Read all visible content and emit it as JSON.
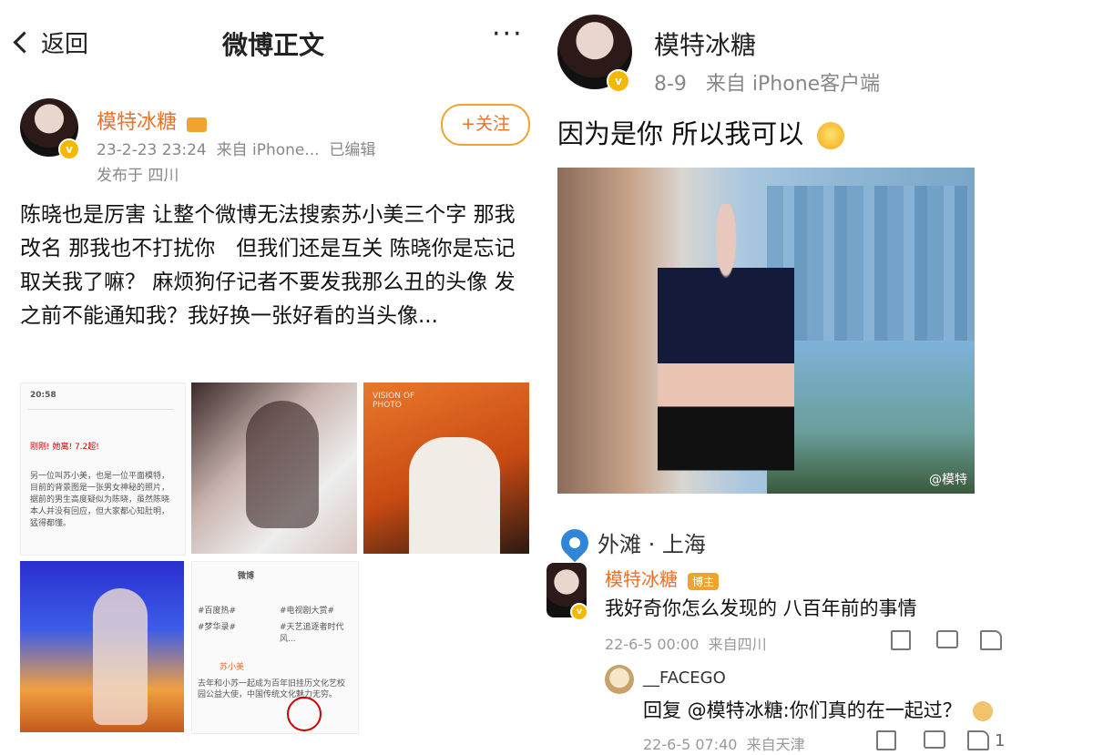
{
  "left": {
    "header": {
      "back_label": "返回",
      "title": "微博正文",
      "more_label": "···"
    },
    "author": {
      "name": "模特冰糖",
      "date": "23-2-23 23:24",
      "source": "来自 iPhone...",
      "edited": "已编辑",
      "location": "发布于 四川"
    },
    "follow_label": "+关注",
    "post_text": "陈晓也是厉害 让整个微博无法搜索苏小美三个字 那我改名 那我也不打扰你　但我们还是互关 陈晓你是忘记取关我了嘛？ 麻烦狗仔记者不要发我那么丑的头像 发之前不能通知我？我好换一张好看的当头像...",
    "thumb1": {
      "time": "20:58",
      "headline": "刚刚! 她离! 7.2超!",
      "body": "另一位叫苏小美，也是一位平面模特，目前的背景图是一张男女神秘的照片，据前的男生高度疑似为陈晓，虽然陈晓本人并没有回应，但大家都心知肚明，猛得都懂。"
    },
    "thumb3": {
      "text": "VISION OF PHOTO"
    },
    "thumb5": {
      "tab": "微博",
      "tags": [
        "#百度热#",
        "#电视剧大赏#",
        "#梦华录#",
        "#天艺追逐者时代风..."
      ],
      "user": "苏小美",
      "body": "去年和小苏一起成为百年旧挂历文化艺校园公益大使，中国传统文化魅力无穷。"
    }
  },
  "right": {
    "author": {
      "name": "模特冰糖",
      "date": "8-9",
      "source": "来自 iPhone客户端"
    },
    "post_text": "因为是你 所以我可以",
    "photo_watermark": "@模特",
    "location": "外滩 · 上海",
    "comments": [
      {
        "name": "模特冰糖",
        "badge": "博主",
        "text": "我好奇你怎么发现的 八百年前的事情",
        "date": "22-6-5 00:00",
        "source": "来自四川",
        "likes": ""
      },
      {
        "name": "__FACEGO",
        "text": "回复 @模特冰糖:你们真的在一起过？",
        "date": "22-6-5 07:40",
        "source": "来自天津",
        "likes": "1"
      }
    ]
  }
}
